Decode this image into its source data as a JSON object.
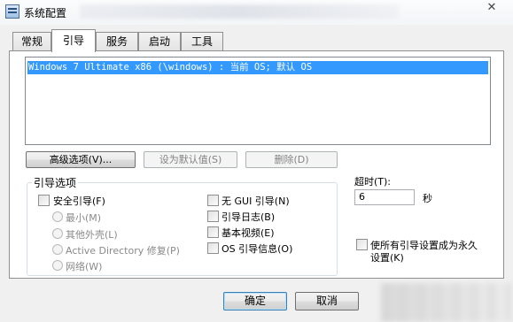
{
  "window": {
    "title": "系统配置",
    "close_glyph": "✕"
  },
  "tabs": [
    {
      "label": "常规"
    },
    {
      "label": "引导"
    },
    {
      "label": "服务"
    },
    {
      "label": "启动"
    },
    {
      "label": "工具"
    }
  ],
  "boot_list": {
    "selected_entry": "Windows 7 Ultimate x86 (\\windows) : 当前 OS; 默认 OS"
  },
  "buttons": {
    "advanced": "高级选项(V)...",
    "set_default": "设为默认值(S)",
    "delete": "删除(D)",
    "ok": "确定",
    "cancel": "取消"
  },
  "boot_options": {
    "title": "引导选项",
    "safe_boot": "安全引导(F)",
    "minimal": "最小(M)",
    "alternate_shell": "其他外壳(L)",
    "ad_repair": "Active Directory 修复(P)",
    "network": "网络(W)",
    "no_gui_boot": "无 GUI 引导(N)",
    "boot_log": "引导日志(B)",
    "base_video": "基本视频(E)",
    "os_boot_info": "OS 引导信息(O)"
  },
  "timeout": {
    "label": "超时(T):",
    "value": "6",
    "unit": "秒"
  },
  "make_permanent": {
    "line1": "使所有引导设置成为永久",
    "line2": "设置(K)"
  },
  "colors": {
    "selection": "#3399ff",
    "panel": "#ffffff",
    "chrome": "#f0f0f0"
  }
}
